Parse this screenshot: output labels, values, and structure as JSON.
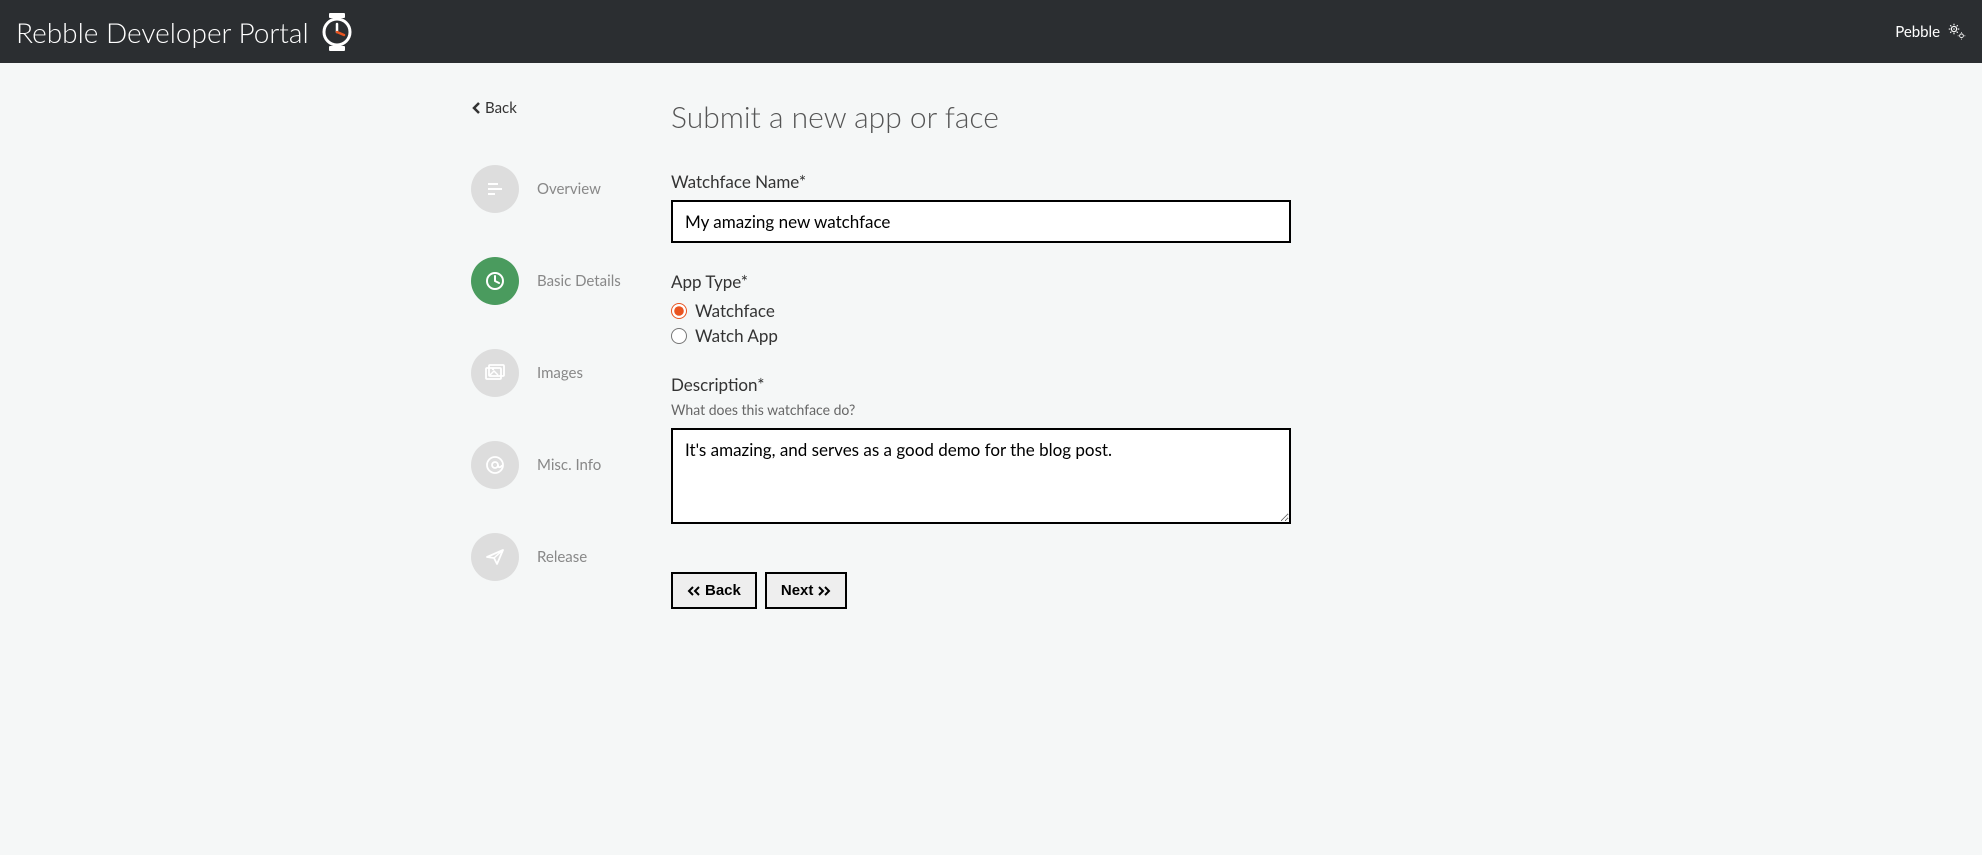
{
  "header": {
    "title": "Rebble Developer Portal",
    "user": "Pebble"
  },
  "sidebar": {
    "back": "Back",
    "steps": [
      {
        "label": "Overview"
      },
      {
        "label": "Basic Details"
      },
      {
        "label": "Images"
      },
      {
        "label": "Misc. Info"
      },
      {
        "label": "Release"
      }
    ]
  },
  "main": {
    "title": "Submit a new app or face",
    "name_label": "Watchface Name*",
    "name_value": "My amazing new watchface",
    "type_label": "App Type*",
    "type_options": {
      "watchface": "Watchface",
      "watchapp": "Watch App"
    },
    "desc_label": "Description*",
    "desc_hint": "What does this watchface do?",
    "desc_value": "It's amazing, and serves as a good demo for the blog post.",
    "btn_back": "Back",
    "btn_next": "Next"
  }
}
